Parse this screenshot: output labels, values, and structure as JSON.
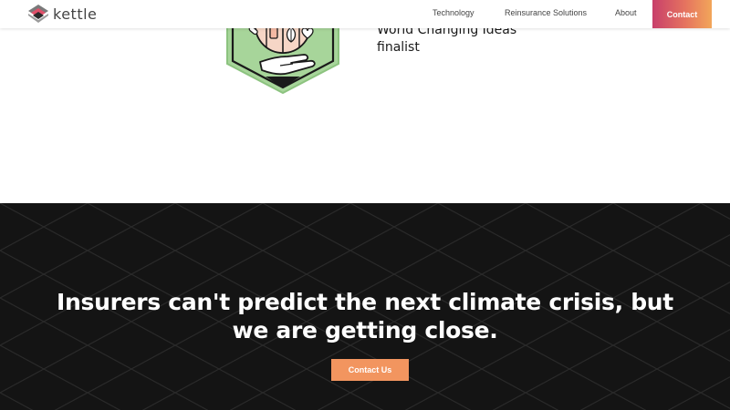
{
  "brand": {
    "name": "kettle",
    "logo_icon": "kettle-layers-logo-icon"
  },
  "nav": {
    "items": [
      {
        "label": "Technology"
      },
      {
        "label": "Reinsurance Solutions"
      },
      {
        "label": "About"
      }
    ],
    "contact_label": "Contact"
  },
  "award": {
    "badge_icon": "world-changing-ideas-badge-icon",
    "line1": "World Changing Ideas",
    "line2": "finalist"
  },
  "cta": {
    "headline_line1": "Insurers can't predict the next climate crisis, but",
    "headline_line2": "we are getting close.",
    "button_label": "Contact Us"
  },
  "colors": {
    "accent_gradient_start": "#c83f6b",
    "accent_gradient_end": "#f2a65a",
    "cta_button": "#f2955f",
    "dark_background": "#141414",
    "badge_green": "#9fd08f"
  }
}
